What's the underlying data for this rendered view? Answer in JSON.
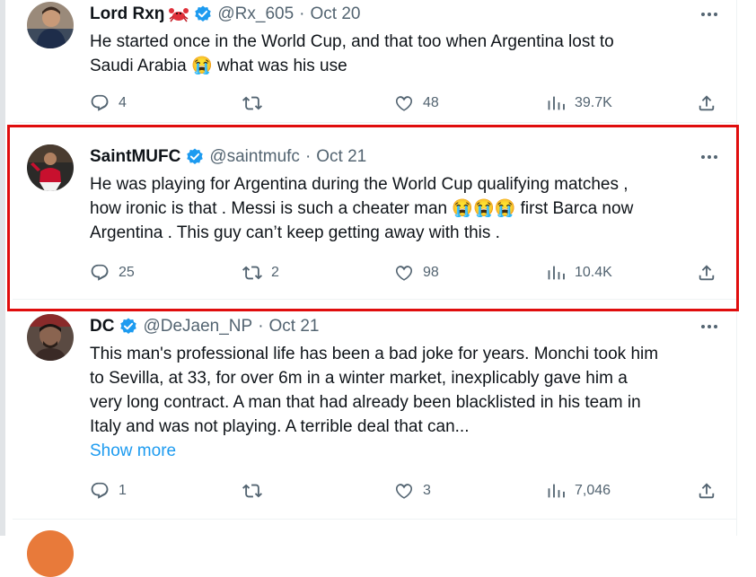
{
  "tweets": [
    {
      "name": "Lord Rxŋ",
      "handle": "@Rx_605",
      "date": "Oct 20",
      "lines": [
        "He started once in the World Cup, and that too when Argentina lost to",
        "Saudi Arabia 😭 what was his use"
      ],
      "replies": "4",
      "reposts": "",
      "likes": "48",
      "views": "39.7K"
    },
    {
      "name": "SaintMUFC",
      "handle": "@saintmufc",
      "date": "Oct 21",
      "lines": [
        "He was playing for Argentina during the World Cup qualifying matches ,",
        "how ironic is that . Messi is such a cheater man 😭😭😭 first Barca now",
        "Argentina . This guy can’t keep getting away with this ."
      ],
      "replies": "25",
      "reposts": "2",
      "likes": "98",
      "views": "10.4K"
    },
    {
      "name": "DC",
      "handle": "@DeJaen_NP",
      "date": "Oct 21",
      "lines": [
        "This man's professional life has been a bad joke for years. Monchi took him",
        "to Sevilla, at 33, for over 6m in a winter market, inexplicably gave him a",
        "very long contract. A man that had already been blacklisted in his team in",
        "Italy and was not playing. A terrible deal that can..."
      ],
      "show_more": "Show more",
      "replies": "1",
      "reposts": "",
      "likes": "3",
      "views": "7,046"
    }
  ],
  "separator_dot": "·",
  "colors": {
    "verified": "#1d9bf0",
    "highlight_border": "#e00d0d",
    "secondary_text": "#536471",
    "link": "#1d9bf0"
  }
}
